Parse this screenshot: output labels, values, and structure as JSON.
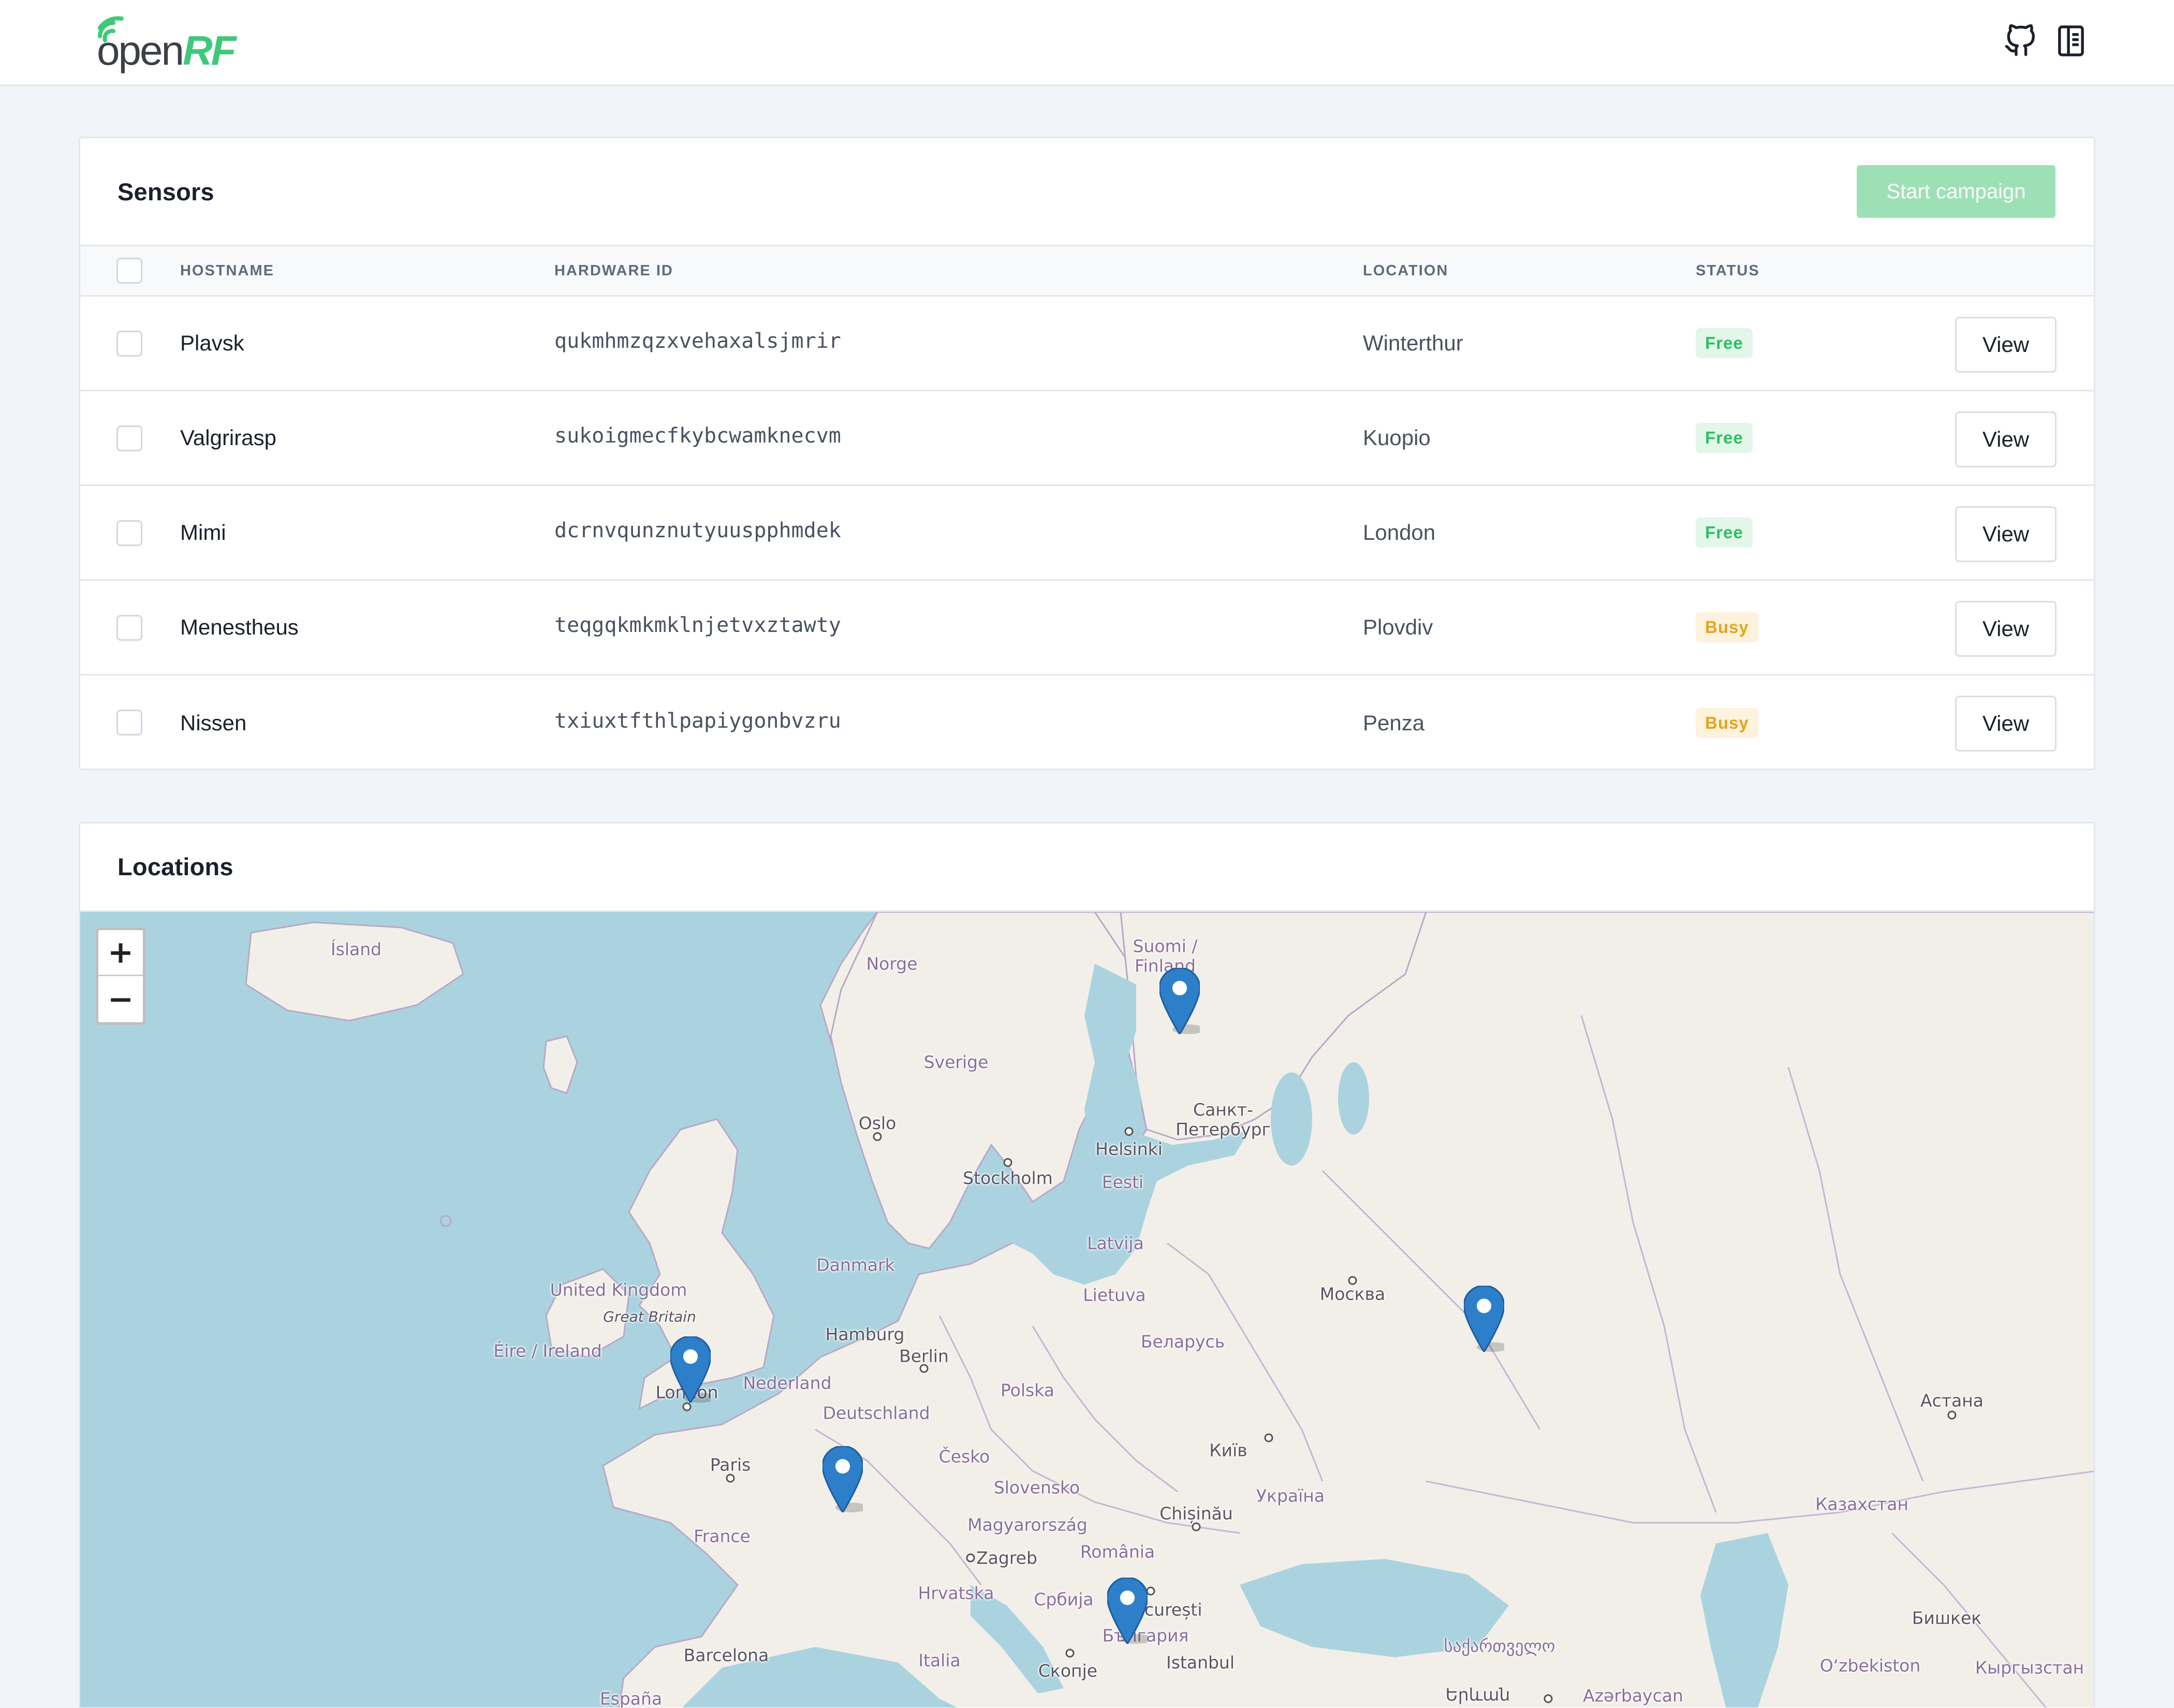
{
  "header": {
    "logo_open": "open",
    "logo_rf": "RF",
    "github_icon": "github-icon",
    "docs_icon": "book-icon"
  },
  "sensors": {
    "title": "Sensors",
    "start_campaign_label": "Start campaign",
    "columns": {
      "hostname": "HOSTNAME",
      "hardware_id": "HARDWARE ID",
      "location": "LOCATION",
      "status": "STATUS"
    },
    "rows": [
      {
        "hostname": "Plavsk",
        "hardware_id": "qukmhmzqzxvehaxalsjmrir",
        "location": "Winterthur",
        "status": "Free",
        "action": "View"
      },
      {
        "hostname": "Valgrirasp",
        "hardware_id": "sukoigmecfkybcwamknecvm",
        "location": "Kuopio",
        "status": "Free",
        "action": "View"
      },
      {
        "hostname": "Mimi",
        "hardware_id": "dcrnvqunznutyuuspphmdek",
        "location": "London",
        "status": "Free",
        "action": "View"
      },
      {
        "hostname": "Menestheus",
        "hardware_id": "teqgqkmkmklnjetvxztawty",
        "location": "Plovdiv",
        "status": "Busy",
        "action": "View"
      },
      {
        "hostname": "Nissen",
        "hardware_id": "txiuxtfthlpapiygonbvzru",
        "location": "Penza",
        "status": "Busy",
        "action": "View"
      }
    ]
  },
  "locations": {
    "title": "Locations",
    "zoom_in": "+",
    "zoom_out": "−",
    "map_labels": [
      "Ísland",
      "Norge",
      "Suomi /",
      "Finland",
      "Sverige",
      "Санкт-",
      "Петербург",
      "Oslo",
      "Helsinki",
      "Stockholm",
      "Eesti",
      "Latvija",
      "Danmark",
      "United Kingdom",
      "Great Britain",
      "Éire / Ireland",
      "Lietuva",
      "Москва",
      "Hamburg",
      "Berlin",
      "Беларусь",
      "London",
      "Nederland",
      "Polska",
      "Deutschland",
      "Астана",
      "Київ",
      "Paris",
      "Česko",
      "Slovensko",
      "Україна",
      "Казахстан",
      "France",
      "Chișinău",
      "Magyarország",
      "Zagreb",
      "România",
      "Hrvatska",
      "Србија",
      "București",
      "България",
      "საქართველო",
      "Бишкек",
      "Barcelona",
      "Italia",
      "Istanbul",
      "Скопје",
      "Oʻzbekiston",
      "Кыргызстан",
      "España",
      "Երևան",
      "Azərbaycan"
    ]
  }
}
